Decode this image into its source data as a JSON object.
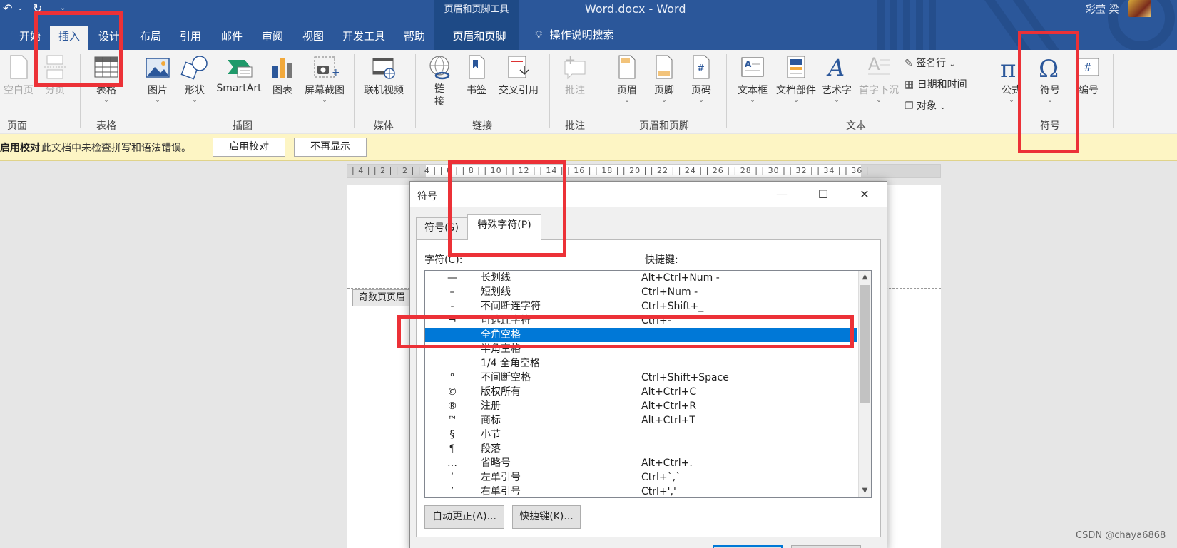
{
  "app": {
    "document_title": "Word.docx  -  Word",
    "context_tool_label": "页眉和页脚工具",
    "user_name": "彩莹 梁"
  },
  "colors": {
    "title_bar": "#2b579a",
    "highlight": "#ec3137",
    "selection": "#0078d7",
    "message_bar": "#fdf5c4"
  },
  "ribbon_tabs": [
    "开始",
    "插入",
    "设计",
    "布局",
    "引用",
    "邮件",
    "审阅",
    "视图",
    "开发工具",
    "帮助",
    "页眉和页脚"
  ],
  "tell_me": "操作说明搜索",
  "ribbon": {
    "pages": {
      "blank_page": "空白页",
      "page_break": "分页",
      "group": "页面"
    },
    "tables": {
      "table": "表格",
      "group": "表格"
    },
    "illustrations": {
      "pictures": "图片",
      "shapes": "形状",
      "smartart": "SmartArt",
      "chart": "图表",
      "screenshot": "屏幕截图",
      "group": "插图"
    },
    "media": {
      "online_video": "联机视频",
      "group": "媒体"
    },
    "links": {
      "link": "链接",
      "bookmark": "书签",
      "cross_ref": "交叉引用",
      "group": "链接"
    },
    "comments": {
      "comment": "批注",
      "group": "批注"
    },
    "header_footer": {
      "header": "页眉",
      "footer": "页脚",
      "page_number": "页码",
      "group": "页眉和页脚"
    },
    "text": {
      "text_box": "文本框",
      "quick_parts": "文档部件",
      "wordart": "艺术字",
      "drop_cap": "首字下沉",
      "signature_line": "签名行",
      "date_time": "日期和时间",
      "object": "对象",
      "group": "文本"
    },
    "symbols": {
      "equation": "公式",
      "symbol": "符号",
      "number": "编号",
      "group": "符号"
    }
  },
  "message_bar": {
    "title": "启用校对",
    "text": "此文档中未检查拼写和语法错误。",
    "enable_button": "启用校对",
    "dont_show_button": "不再显示"
  },
  "ruler_text": "| 4 |  | 2 |      | 2 |  | 4 |  | 6 |  | 8 |  | 10 |  | 12 |  | 14 |  | 16 |  | 18 |  | 20 |  | 22 |  | 24 |  | 26 |  | 28 |  | 30 |  | 32 |  | 34 |  | 36 |",
  "document": {
    "header_tag": "奇数页页眉"
  },
  "dialog": {
    "title": "符号",
    "tabs": [
      "符号(S)",
      "特殊字符(P)"
    ],
    "active_tab": "特殊字符(P)",
    "col_character": "字符(C):",
    "col_shortcut": "快捷键:",
    "rows": [
      {
        "symbol": "—",
        "name": "长划线",
        "shortcut": "Alt+Ctrl+Num -"
      },
      {
        "symbol": "–",
        "name": "短划线",
        "shortcut": "Ctrl+Num -"
      },
      {
        "symbol": "-",
        "name": "不间断连字符",
        "shortcut": "Ctrl+Shift+_"
      },
      {
        "symbol": "¬",
        "name": "可选连字符",
        "shortcut": "Ctrl+-"
      },
      {
        "symbol": "",
        "name": "全角空格",
        "shortcut": ""
      },
      {
        "symbol": "",
        "name": "半角空格",
        "shortcut": ""
      },
      {
        "symbol": "",
        "name": "1/4 全角空格",
        "shortcut": ""
      },
      {
        "symbol": "°",
        "name": "不间断空格",
        "shortcut": "Ctrl+Shift+Space"
      },
      {
        "symbol": "©",
        "name": "版权所有",
        "shortcut": "Alt+Ctrl+C"
      },
      {
        "symbol": "®",
        "name": "注册",
        "shortcut": "Alt+Ctrl+R"
      },
      {
        "symbol": "™",
        "name": "商标",
        "shortcut": "Alt+Ctrl+T"
      },
      {
        "symbol": "§",
        "name": "小节",
        "shortcut": ""
      },
      {
        "symbol": "¶",
        "name": "段落",
        "shortcut": ""
      },
      {
        "symbol": "…",
        "name": "省略号",
        "shortcut": "Alt+Ctrl+."
      },
      {
        "symbol": "‘",
        "name": "左单引号",
        "shortcut": "Ctrl+`,`"
      },
      {
        "symbol": "’",
        "name": "右单引号",
        "shortcut": "Ctrl+','"
      }
    ],
    "selected_row": "全角空格",
    "autocorrect_button": "自动更正(A)...",
    "shortcut_button": "快捷键(K)..."
  },
  "watermark": "CSDN @chaya6868"
}
